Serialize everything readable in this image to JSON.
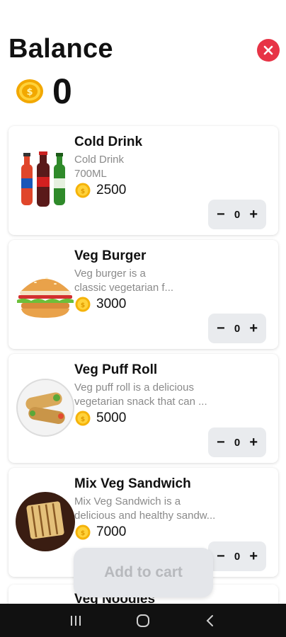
{
  "header": {
    "title": "Balance"
  },
  "balance": {
    "value": "0"
  },
  "products": [
    {
      "name": "Cold Drink",
      "desc_lines": [
        "Cold Drink",
        "700ML"
      ],
      "price": "2500",
      "quantity": "0",
      "image_icon": "cold-drink-bottles"
    },
    {
      "name": "Veg Burger",
      "desc_lines": [
        "Veg burger is a",
        "classic vegetarian f..."
      ],
      "price": "3000",
      "quantity": "0",
      "image_icon": "burger"
    },
    {
      "name": "Veg Puff Roll",
      "desc_lines": [
        "Veg puff roll is a delicious",
        "vegetarian snack that can ..."
      ],
      "price": "5000",
      "quantity": "0",
      "image_icon": "puff-roll"
    },
    {
      "name": "Mix Veg Sandwich",
      "desc_lines": [
        "Mix Veg Sandwich is a",
        "delicious and healthy sandw..."
      ],
      "price": "7000",
      "quantity": "0",
      "image_icon": "sandwich"
    }
  ],
  "partial_product": {
    "name": "Veg Noodles"
  },
  "stepper": {
    "minus": "−",
    "plus": "+"
  },
  "cart": {
    "label": "Add to cart"
  },
  "colors": {
    "accent_red": "#e73446",
    "coin_gold": "#f5b30a",
    "stepper_bg": "#e9ebee"
  }
}
